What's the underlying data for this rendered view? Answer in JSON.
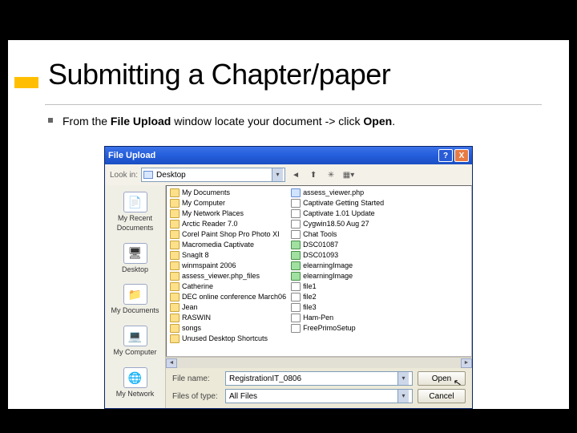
{
  "slide": {
    "title": "Submitting a Chapter/paper",
    "bullet_pre": "From the ",
    "bullet_bold1": "File Upload",
    "bullet_mid": " window locate your document -> click ",
    "bullet_bold2": "Open",
    "bullet_end": "."
  },
  "dialog": {
    "title": "File Upload",
    "help": "?",
    "close": "X",
    "look_in_label": "Look in:",
    "look_in_value": "Desktop",
    "places": [
      {
        "label": "My Recent Documents",
        "icon": "📄"
      },
      {
        "label": "Desktop",
        "icon": "🖥"
      },
      {
        "label": "My Documents",
        "icon": "📁"
      },
      {
        "label": "My Computer",
        "icon": "💻"
      },
      {
        "label": "My Network",
        "icon": "🌐"
      }
    ],
    "files_col1": [
      {
        "name": "My Documents",
        "t": "folder"
      },
      {
        "name": "My Computer",
        "t": "folder"
      },
      {
        "name": "My Network Places",
        "t": "folder"
      },
      {
        "name": "Arctic Reader 7.0",
        "t": "folder"
      },
      {
        "name": "Corel Paint Shop Pro Photo XI",
        "t": "folder"
      },
      {
        "name": "Macromedia Captivate",
        "t": "folder"
      },
      {
        "name": "SnagIt 8",
        "t": "folder"
      },
      {
        "name": "winmspaint 2006",
        "t": "folder"
      },
      {
        "name": "assess_viewer.php_files",
        "t": "folder"
      },
      {
        "name": "Catherine",
        "t": "folder"
      },
      {
        "name": "DEC online conference March06",
        "t": "folder"
      },
      {
        "name": "Jean",
        "t": "folder"
      },
      {
        "name": "RASWIN",
        "t": "folder"
      },
      {
        "name": "songs",
        "t": "folder"
      },
      {
        "name": "Unused Desktop Shortcuts",
        "t": "folder"
      }
    ],
    "files_col2": [
      {
        "name": "assess_viewer.php",
        "t": "php"
      },
      {
        "name": "Captivate Getting Started",
        "t": "file"
      },
      {
        "name": "Captivate 1.01 Update",
        "t": "file"
      },
      {
        "name": "Cygwin18.50 Aug 27",
        "t": "file"
      },
      {
        "name": "Chat Tools",
        "t": "file"
      },
      {
        "name": "DSC01087",
        "t": "img"
      },
      {
        "name": "DSC01093",
        "t": "img"
      },
      {
        "name": "elearningImage",
        "t": "img"
      },
      {
        "name": "elearningImage",
        "t": "img"
      },
      {
        "name": "file1",
        "t": "file"
      },
      {
        "name": "file2",
        "t": "file"
      },
      {
        "name": "file3",
        "t": "file"
      },
      {
        "name": "Ham-Pen",
        "t": "file"
      },
      {
        "name": "FreePrimoSetup",
        "t": "file"
      }
    ],
    "file_name_label": "File name:",
    "file_name_value": "RegistrationIT_0806",
    "file_type_label": "Files of type:",
    "file_type_value": "All Files",
    "open_btn": "Open",
    "cancel_btn": "Cancel"
  }
}
